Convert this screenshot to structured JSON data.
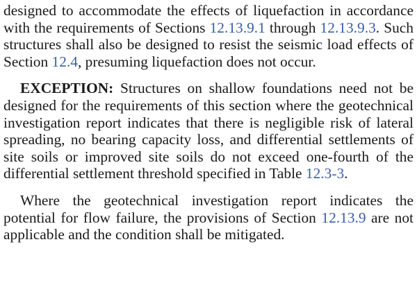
{
  "paragraphs": {
    "p1": {
      "t1": "designed to accommodate the effects of liquefaction in accordance with the requirements of Sections ",
      "link1": "12.13.9.1",
      "t2": " through ",
      "link2": "12.13.9.3",
      "t3": ". Such structures shall also be designed to resist the seismic load effects of Section ",
      "link3": "12.4",
      "t4": ", presuming liquefaction does not occur."
    },
    "p2": {
      "label": "EXCEPTION:",
      "t1": " Structures on shallow foundations need not be designed for the requirements of this section where the geotechnical investigation report indicates that there is negligible risk of lateral spreading, no bearing capacity loss, and differential settlements of site soils or improved site soils do not exceed one-fourth of the differential settlement threshold specified in Table ",
      "link1": "12.3-3",
      "t2": "."
    },
    "p3": {
      "t1": "Where the geotechnical investigation report indicates the potential for flow failure, the provisions of Section ",
      "link1": "12.13.9",
      "t2": " are not applicable and the condition shall be mitigated."
    }
  },
  "colors": {
    "text": "#1a1a1a",
    "link": "#3a5ca9",
    "background": "#ffffff"
  }
}
